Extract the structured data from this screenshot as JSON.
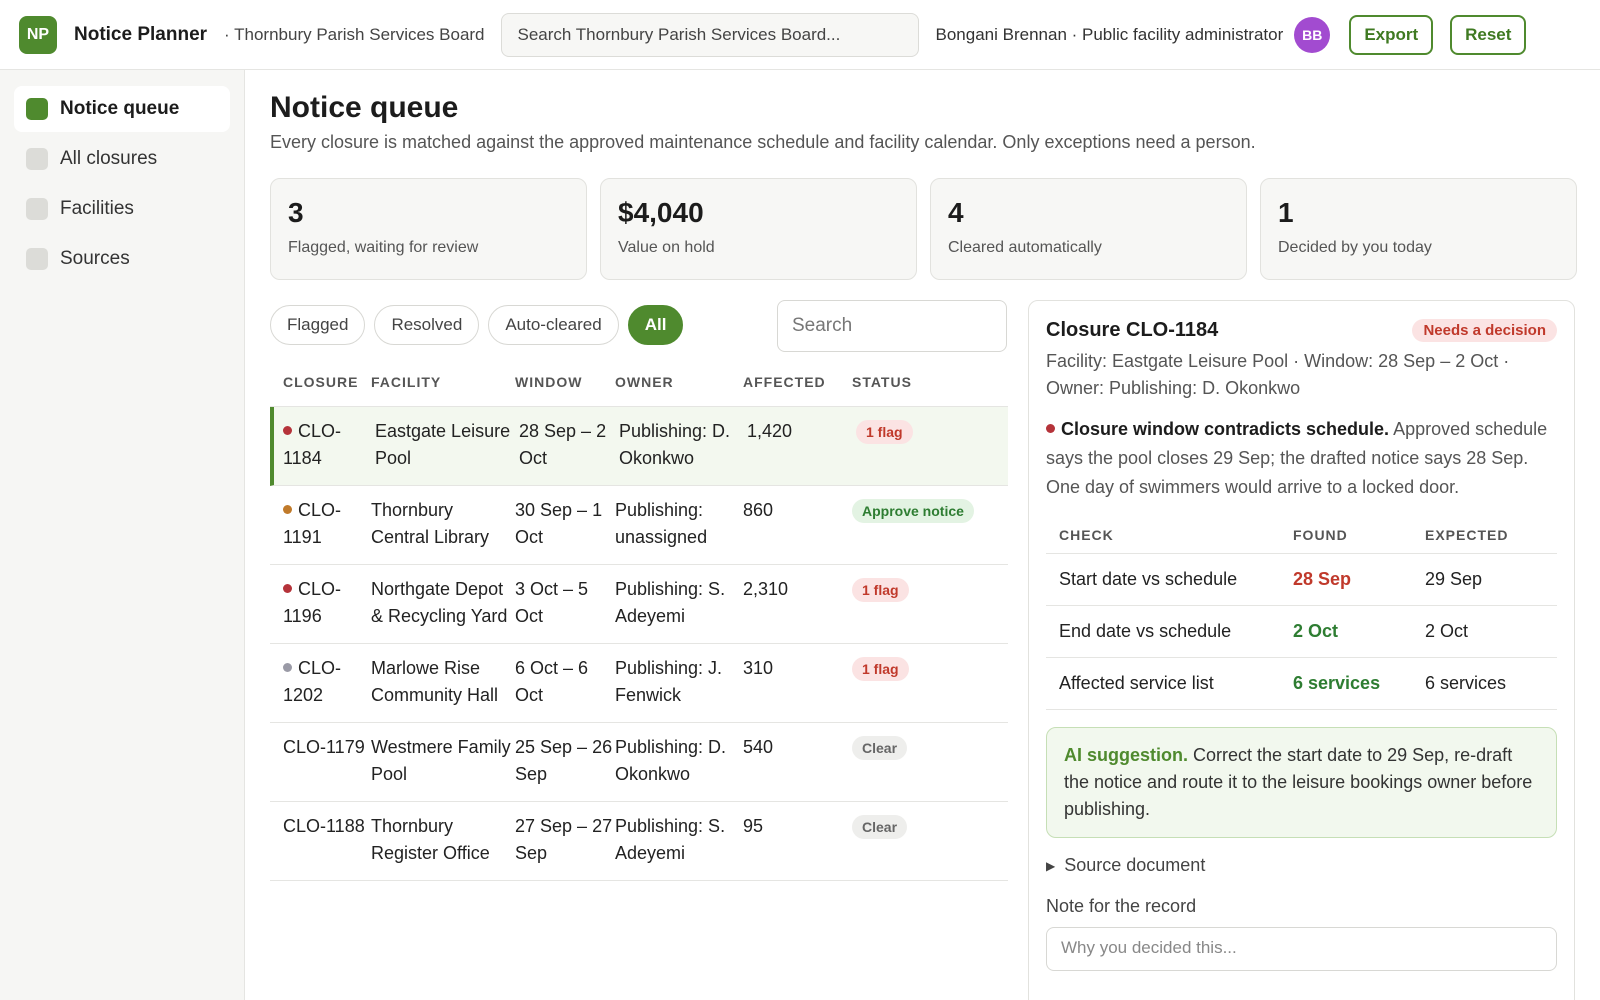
{
  "header": {
    "logo": "NP",
    "app_title": "Notice Planner",
    "org": "· Thornbury Parish Services Board",
    "search_placeholder": "Search Thornbury Parish Services Board...",
    "user": "Bongani Brennan · Public facility administrator",
    "avatar": "BB",
    "export_label": "Export",
    "reset_label": "Reset"
  },
  "sidebar": {
    "items": [
      {
        "label": "Notice queue"
      },
      {
        "label": "All closures"
      },
      {
        "label": "Facilities"
      },
      {
        "label": "Sources"
      }
    ]
  },
  "main": {
    "title": "Notice queue",
    "subtitle": "Every closure is matched against the approved maintenance schedule and facility calendar. Only exceptions need a person.",
    "stats": [
      {
        "value": "3",
        "label": "Flagged, waiting for review"
      },
      {
        "value": "$4,040",
        "label": "Value on hold"
      },
      {
        "value": "4",
        "label": "Cleared automatically"
      },
      {
        "value": "1",
        "label": "Decided by you today"
      }
    ],
    "filters": [
      "Flagged",
      "Resolved",
      "Auto-cleared",
      "All"
    ],
    "search_placeholder": "Search"
  },
  "table": {
    "headers": [
      "CLOSURE",
      "FACILITY",
      "WINDOW",
      "OWNER",
      "AFFECTED",
      "STATUS"
    ],
    "rows": [
      {
        "dot": "#b5333a",
        "id": "CLO-1184",
        "facility": "Eastgate Leisure Pool",
        "window": "28 Sep – 2 Oct",
        "owner": "Publishing: D. Okonkwo",
        "affected": "1,420",
        "status": "1 flag"
      },
      {
        "dot": "#c07a2a",
        "id": "CLO-1191",
        "facility": "Thornbury Central Library",
        "window": "30 Sep – 1 Oct",
        "owner": "Publishing: unassigned",
        "affected": "860",
        "status": "Approve notice"
      },
      {
        "dot": "#b5333a",
        "id": "CLO-1196",
        "facility": "Northgate Depot & Recycling Yard",
        "window": "3 Oct – 5 Oct",
        "owner": "Publishing: S. Adeyemi",
        "affected": "2,310",
        "status": "1 flag"
      },
      {
        "dot": "#9a9aa6",
        "id": "CLO-1202",
        "facility": "Marlowe Rise Community Hall",
        "window": "6 Oct – 6 Oct",
        "owner": "Publishing: J. Fenwick",
        "affected": "310",
        "status": "1 flag"
      },
      {
        "dot": "",
        "id": "CLO-1179",
        "facility": "Westmere Family Pool",
        "window": "25 Sep – 26 Sep",
        "owner": "Publishing: D. Okonkwo",
        "affected": "540",
        "status": "Clear"
      },
      {
        "dot": "",
        "id": "CLO-1188",
        "facility": "Thornbury Register Office",
        "window": "27 Sep – 27 Sep",
        "owner": "Publishing: S. Adeyemi",
        "affected": "95",
        "status": "Clear"
      }
    ]
  },
  "detail": {
    "title": "Closure CLO-1184",
    "badge": "Needs a decision",
    "meta": "Facility: Eastgate Leisure Pool · Window: 28 Sep – 2 Oct · Owner: Publishing: D. Okonkwo",
    "issue_title": "Closure window contradicts schedule.",
    "issue_text": "Approved schedule says the pool closes 29 Sep; the drafted notice says 28 Sep. One day of swimmers would arrive to a locked door.",
    "check_headers": [
      "CHECK",
      "FOUND",
      "EXPECTED"
    ],
    "checks": [
      {
        "check": "Start date vs schedule",
        "found": "28 Sep",
        "expected": "29 Sep"
      },
      {
        "check": "End date vs schedule",
        "found": "2 Oct",
        "expected": "2 Oct"
      },
      {
        "check": "Affected service list",
        "found": "6 services",
        "expected": "6 services"
      }
    ],
    "ai_label": "AI suggestion.",
    "ai_text": "Correct the start date to 29 Sep, re-draft the notice and route it to the leisure bookings owner before publishing.",
    "source_label": "Source document",
    "note_label": "Note for the record",
    "note_placeholder": "Why you decided this..."
  }
}
